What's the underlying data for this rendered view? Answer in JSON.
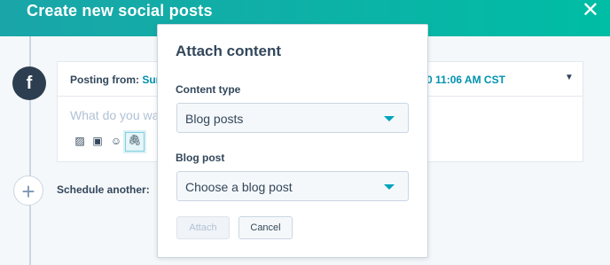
{
  "header": {
    "title": "Create new social posts",
    "close_glyph": "✕"
  },
  "network": {
    "icon": "facebook-icon",
    "glyph": "f"
  },
  "post": {
    "posting_from_label": "Posting from:",
    "posting_from_value": "Sun",
    "time": "0 11:06 AM CST",
    "caret": "▼",
    "placeholder": "What do you wa"
  },
  "tools": {
    "image": "▨",
    "video": "▣",
    "emoji": "☺",
    "attach": "🖇"
  },
  "schedule": {
    "add_glyph": "+",
    "label": "Schedule another:"
  },
  "modal": {
    "title": "Attach content",
    "content_type_label": "Content type",
    "content_type_value": "Blog posts",
    "blog_post_label": "Blog post",
    "blog_post_placeholder": "Choose a blog post",
    "attach_label": "Attach",
    "cancel_label": "Cancel"
  },
  "colors": {
    "header": "#1aa5a8",
    "accent": "#00a4bd",
    "text": "#33475b",
    "facebook": "#2d3e50"
  }
}
